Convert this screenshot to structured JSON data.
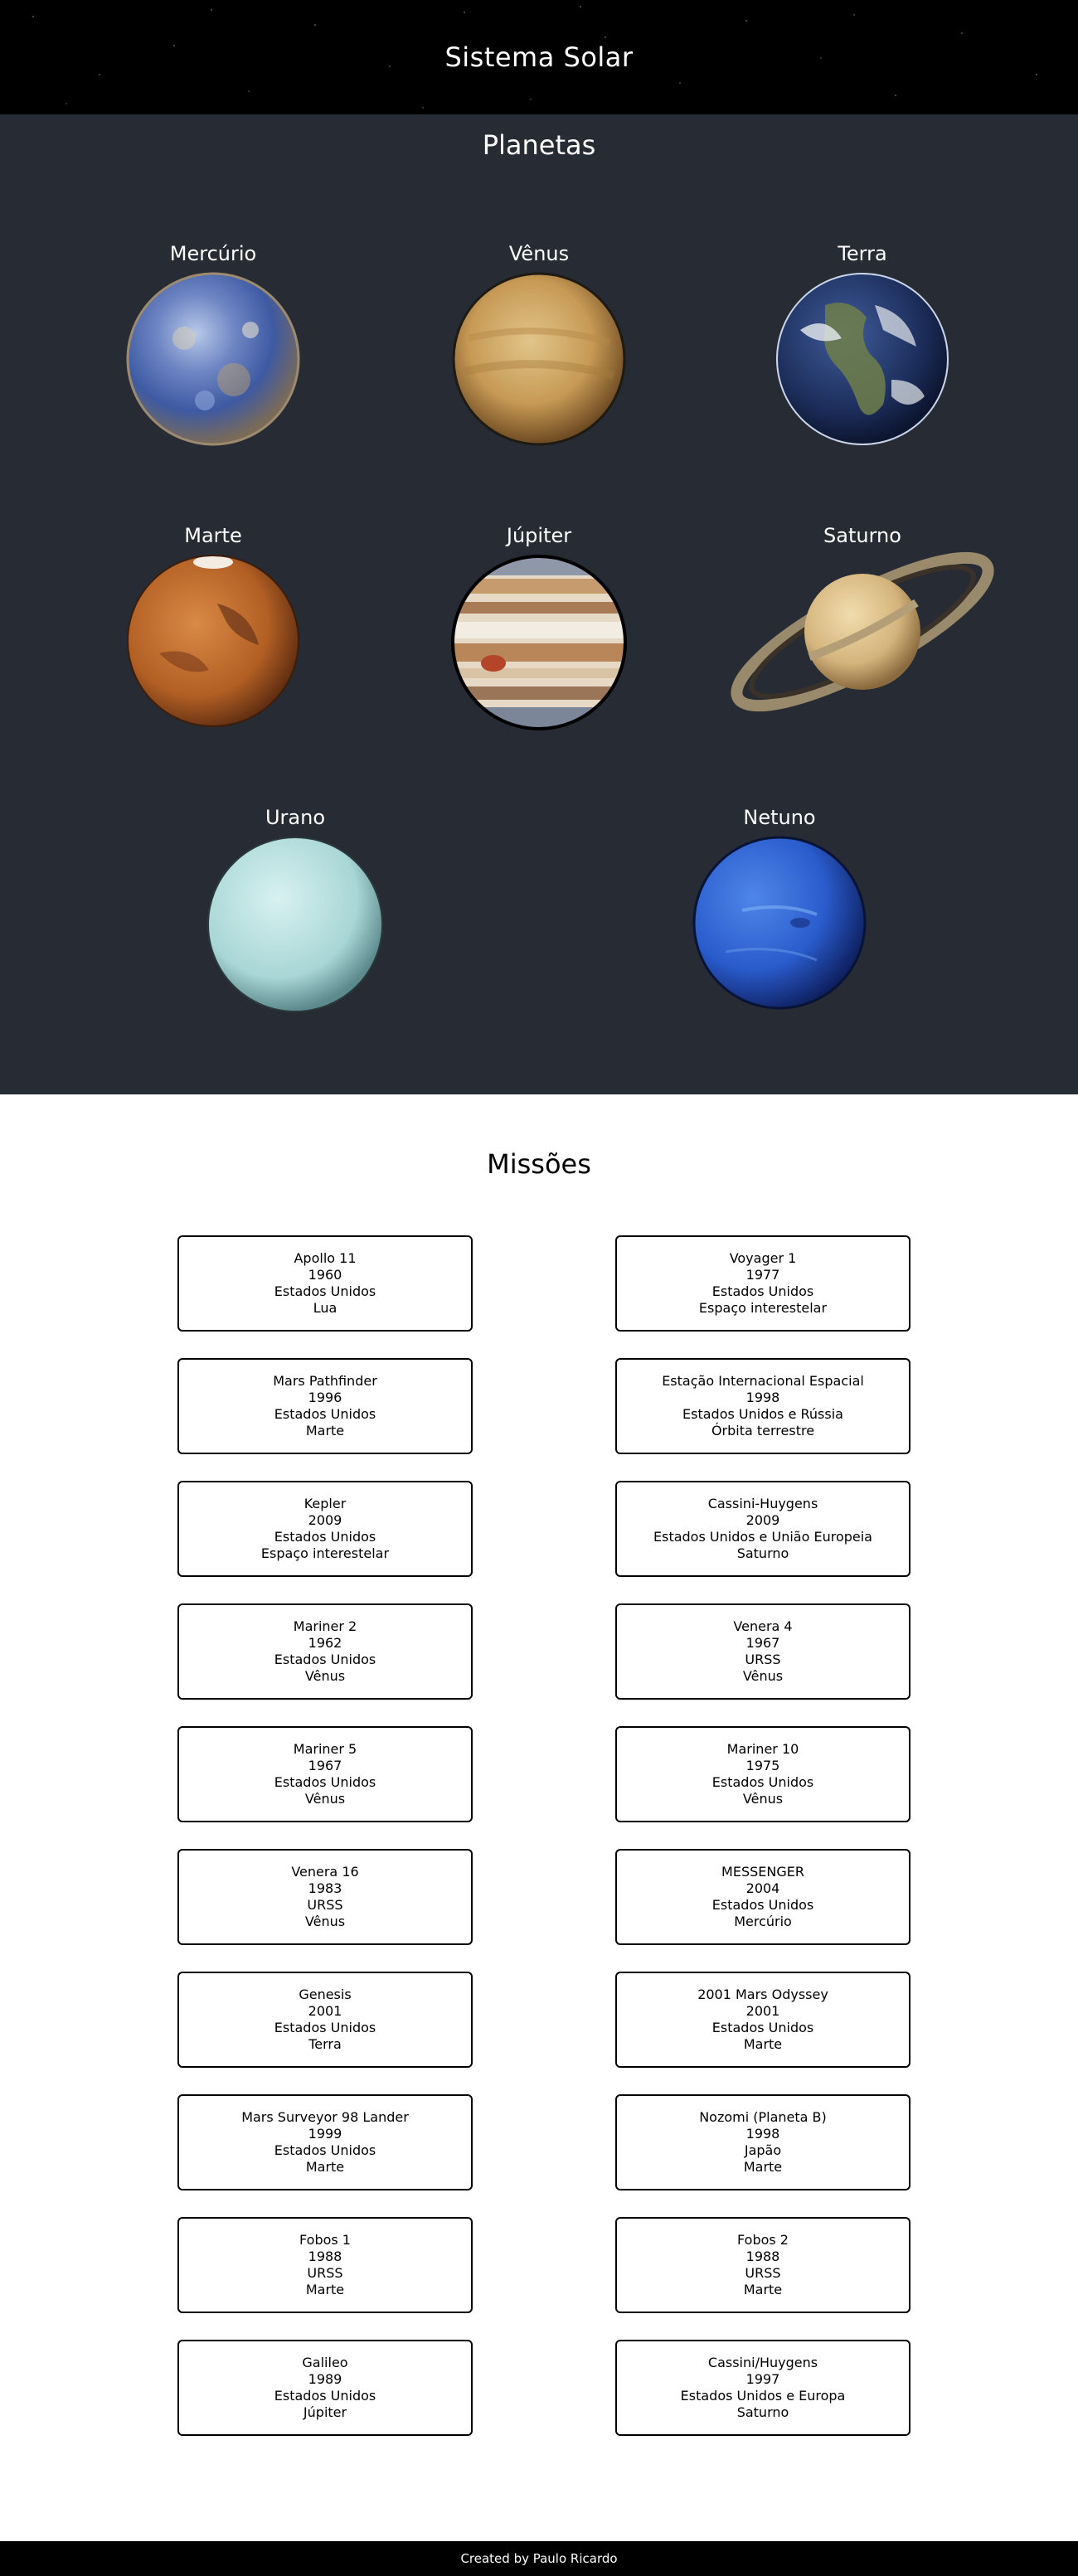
{
  "header": {
    "title": "Sistema Solar"
  },
  "planets_section": {
    "title": "Planetas",
    "planets": [
      {
        "name": "Mercúrio"
      },
      {
        "name": "Vênus"
      },
      {
        "name": "Terra"
      },
      {
        "name": "Marte"
      },
      {
        "name": "Júpiter"
      },
      {
        "name": "Saturno"
      },
      {
        "name": "Urano"
      },
      {
        "name": "Netuno"
      }
    ]
  },
  "missions_section": {
    "title": "Missões",
    "missions": [
      {
        "name": "Apollo 11",
        "year": "1960",
        "country": "Estados Unidos",
        "destination": "Lua"
      },
      {
        "name": "Voyager 1",
        "year": "1977",
        "country": "Estados Unidos",
        "destination": "Espaço interestelar"
      },
      {
        "name": "Mars Pathfinder",
        "year": "1996",
        "country": "Estados Unidos",
        "destination": "Marte"
      },
      {
        "name": "Estação Internacional Espacial",
        "year": "1998",
        "country": "Estados Unidos e Rússia",
        "destination": "Órbita terrestre"
      },
      {
        "name": "Kepler",
        "year": "2009",
        "country": "Estados Unidos",
        "destination": "Espaço interestelar"
      },
      {
        "name": "Cassini-Huygens",
        "year": "2009",
        "country": "Estados Unidos e União Europeia",
        "destination": "Saturno"
      },
      {
        "name": "Mariner 2",
        "year": "1962",
        "country": "Estados Unidos",
        "destination": "Vênus"
      },
      {
        "name": "Venera 4",
        "year": "1967",
        "country": "URSS",
        "destination": "Vênus"
      },
      {
        "name": "Mariner 5",
        "year": "1967",
        "country": "Estados Unidos",
        "destination": "Vênus"
      },
      {
        "name": "Mariner 10",
        "year": "1975",
        "country": "Estados Unidos",
        "destination": "Vênus"
      },
      {
        "name": "Venera 16",
        "year": "1983",
        "country": "URSS",
        "destination": "Vênus"
      },
      {
        "name": "MESSENGER",
        "year": "2004",
        "country": "Estados Unidos",
        "destination": "Mercúrio"
      },
      {
        "name": "Genesis",
        "year": "2001",
        "country": "Estados Unidos",
        "destination": "Terra"
      },
      {
        "name": "2001 Mars Odyssey",
        "year": "2001",
        "country": "Estados Unidos",
        "destination": "Marte"
      },
      {
        "name": "Mars Surveyor 98 Lander",
        "year": "1999",
        "country": "Estados Unidos",
        "destination": "Marte"
      },
      {
        "name": "Nozomi (Planeta B)",
        "year": "1998",
        "country": "Japão",
        "destination": "Marte"
      },
      {
        "name": "Fobos 1",
        "year": "1988",
        "country": "URSS",
        "destination": "Marte"
      },
      {
        "name": "Fobos 2",
        "year": "1988",
        "country": "URSS",
        "destination": "Marte"
      },
      {
        "name": "Galileo",
        "year": "1989",
        "country": "Estados Unidos",
        "destination": "Júpiter"
      },
      {
        "name": "Cassini/Huygens",
        "year": "1997",
        "country": "Estados Unidos e Europa",
        "destination": "Saturno"
      }
    ]
  },
  "footer": {
    "text": "Created by Paulo Ricardo"
  }
}
